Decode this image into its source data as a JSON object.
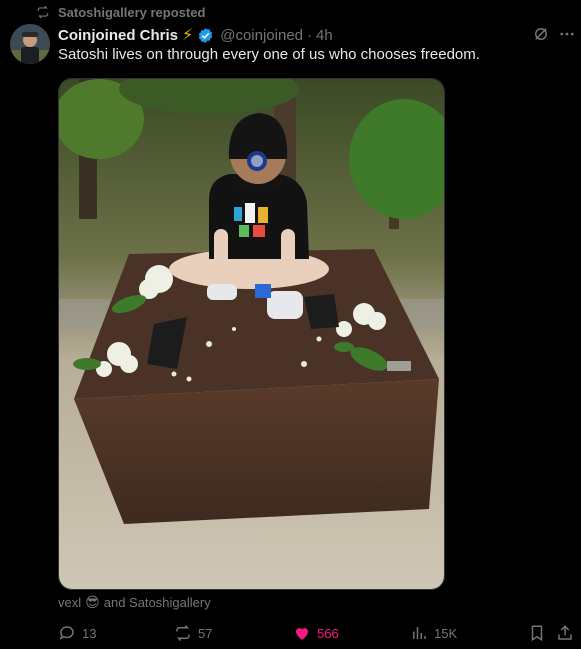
{
  "repost": {
    "label": "Satoshigallery reposted"
  },
  "author": {
    "name": "Coinjoined Chris",
    "emoji": "⚡",
    "handle": "@coinjoined",
    "separator": "·",
    "time": "4h"
  },
  "tweet": {
    "text": "Satoshi lives on through every one of us who chooses freedom."
  },
  "social_context": {
    "user": "vexl",
    "emoji": "😎",
    "rest": "and Satoshigallery"
  },
  "actions": {
    "replies": "13",
    "reposts": "57",
    "likes": "566",
    "views": "15K"
  },
  "colors": {
    "accent": "#1d9bf0",
    "like": "#f91880",
    "muted": "#71767b"
  }
}
